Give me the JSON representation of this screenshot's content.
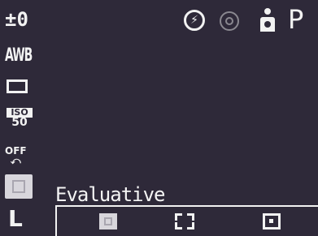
{
  "left_column": {
    "exposure_comp": "±0",
    "white_balance": "AWB",
    "iso_top": "ISO",
    "iso_value": "50",
    "flash_label": "OFF",
    "resolution": "L"
  },
  "status": {
    "mode": "P"
  },
  "metering": {
    "current_label": "Evaluative",
    "options": [
      "evaluative",
      "center-weighted",
      "spot"
    ],
    "selected": "evaluative"
  },
  "icons": {
    "exposure": "exposure-comp-icon",
    "white_balance": "awb-icon",
    "drive": "single-shot-drive-icon",
    "iso": "iso-icon",
    "flash": "flash-off-icon",
    "metering": "evaluative-metering-icon",
    "resolution": "large-resolution-icon",
    "flash_auto": "flash-auto-icon",
    "red_eye": "red-eye-icon",
    "person": "self-timer-person-icon"
  }
}
